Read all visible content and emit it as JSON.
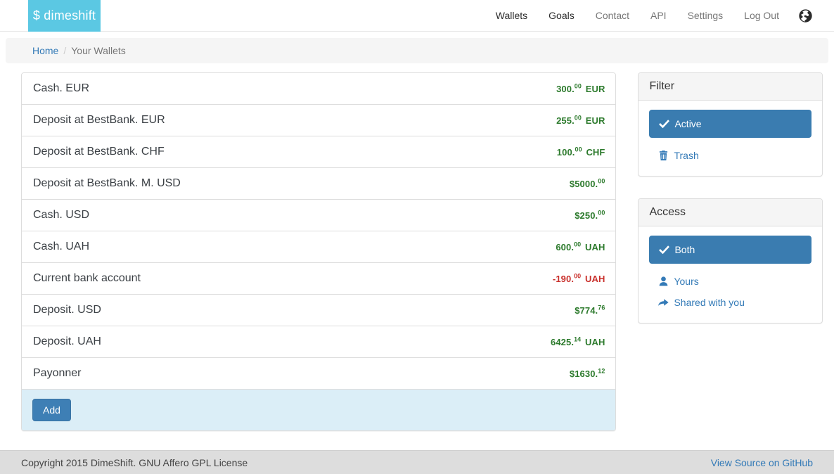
{
  "navbar": {
    "brand": "$ dimeshift",
    "links": [
      {
        "label": "Wallets",
        "active": true
      },
      {
        "label": "Goals",
        "active": true
      },
      {
        "label": "Contact",
        "active": false
      },
      {
        "label": "API",
        "active": false
      },
      {
        "label": "Settings",
        "active": false
      },
      {
        "label": "Log Out",
        "active": false
      }
    ],
    "globe_icon": "globe-icon"
  },
  "breadcrumb": {
    "home": "Home",
    "separator": "/",
    "current": "Your Wallets"
  },
  "wallets": [
    {
      "name": "Cash. EUR",
      "prefix": "",
      "integer": "300",
      "decimals": "00",
      "currency": "EUR",
      "negative": false
    },
    {
      "name": "Deposit at BestBank. EUR",
      "prefix": "",
      "integer": "255",
      "decimals": "00",
      "currency": "EUR",
      "negative": false
    },
    {
      "name": "Deposit at BestBank. CHF",
      "prefix": "",
      "integer": "100",
      "decimals": "00",
      "currency": "CHF",
      "negative": false
    },
    {
      "name": "Deposit at BestBank. M. USD",
      "prefix": "$",
      "integer": "5000",
      "decimals": "00",
      "currency": "",
      "negative": false
    },
    {
      "name": "Cash. USD",
      "prefix": "$",
      "integer": "250",
      "decimals": "00",
      "currency": "",
      "negative": false
    },
    {
      "name": "Cash. UAH",
      "prefix": "",
      "integer": "600",
      "decimals": "00",
      "currency": "UAH",
      "negative": false
    },
    {
      "name": "Current bank account",
      "prefix": "",
      "integer": "-190",
      "decimals": "00",
      "currency": "UAH",
      "negative": true
    },
    {
      "name": "Deposit. USD",
      "prefix": "$",
      "integer": "774",
      "decimals": "76",
      "currency": "",
      "negative": false
    },
    {
      "name": "Deposit. UAH",
      "prefix": "",
      "integer": "6425",
      "decimals": "14",
      "currency": "UAH",
      "negative": false
    },
    {
      "name": "Payonner",
      "prefix": "$",
      "integer": "1630",
      "decimals": "12",
      "currency": "",
      "negative": false
    }
  ],
  "add_button": "Add",
  "sidebar": {
    "filter": {
      "title": "Filter",
      "active_option": "Active",
      "trash_option": "Trash"
    },
    "access": {
      "title": "Access",
      "both_option": "Both",
      "yours_option": "Yours",
      "shared_option": "Shared with you"
    }
  },
  "footer": {
    "copyright": "Copyright 2015 DimeShift. GNU Affero GPL License",
    "source_link": "View Source on GitHub"
  },
  "colors": {
    "brand_bg": "#5bc8e3",
    "link": "#337ab7",
    "selected_bg": "#3a7cb0",
    "amount_positive": "#2c7a2c",
    "amount_negative": "#c9302c",
    "footer_bg": "#dddddd",
    "add_footer_bg": "#dbeef7"
  }
}
